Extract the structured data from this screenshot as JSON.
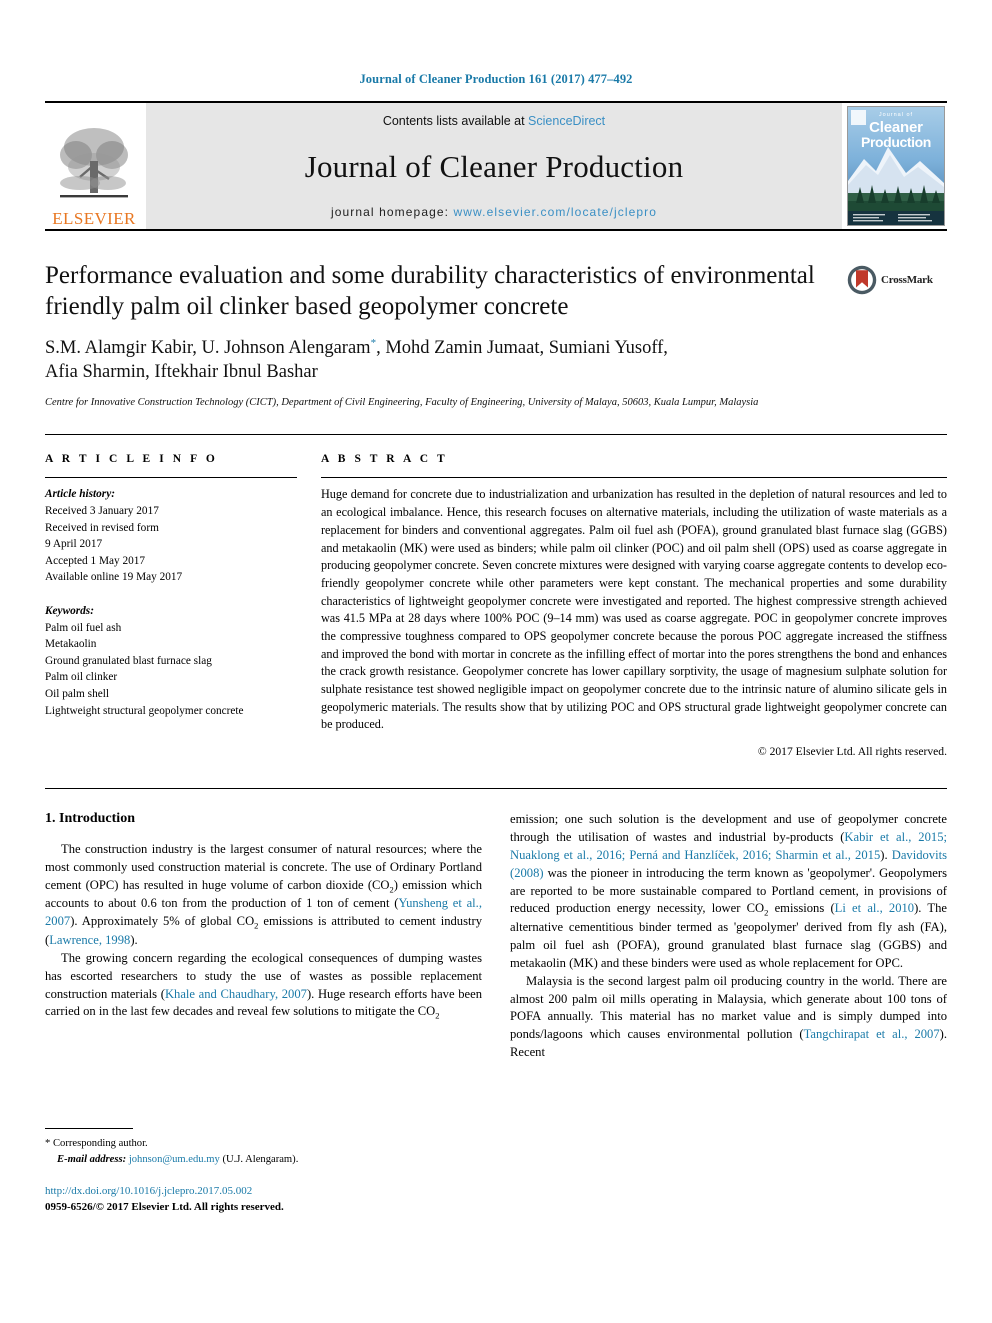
{
  "running_head": "Journal of Cleaner Production 161 (2017) 477–492",
  "masthead": {
    "publisher_name": "ELSEVIER",
    "contents_prefix": "Contents lists available at ",
    "contents_link": "ScienceDirect",
    "journal_name": "Journal of Cleaner Production",
    "homepage_prefix": "journal homepage: ",
    "homepage_url": "www.elsevier.com/locate/jclepro",
    "cover": {
      "line_small": "Journal of",
      "line_big_1": "Cleaner",
      "line_big_2": "Production"
    }
  },
  "article": {
    "title": "Performance evaluation and some durability characteristics of environmental friendly palm oil clinker based geopolymer concrete",
    "crossmark_label": "CrossMark",
    "authors_line1_a": "S.M. Alamgir Kabir, U. Johnson Alengaram",
    "authors_marker": "*",
    "authors_line1_b": ", Mohd Zamin Jumaat, Sumiani Yusoff,",
    "authors_line2": "Afia Sharmin, Iftekhair Ibnul Bashar",
    "affiliation": "Centre for Innovative Construction Technology (CICT), Department of Civil Engineering, Faculty of Engineering, University of Malaya, 50603, Kuala Lumpur, Malaysia"
  },
  "article_info": {
    "heading": "A R T I C L E   I N F O",
    "history_label": "Article history:",
    "history": [
      "Received 3 January 2017",
      "Received in revised form",
      "9 April 2017",
      "Accepted 1 May 2017",
      "Available online 19 May 2017"
    ],
    "keywords_label": "Keywords:",
    "keywords": [
      "Palm oil fuel ash",
      "Metakaolin",
      "Ground granulated blast furnace slag",
      "Palm oil clinker",
      "Oil palm shell",
      "Lightweight structural geopolymer concrete"
    ]
  },
  "abstract": {
    "heading": "A B S T R A C T",
    "text": "Huge demand for concrete due to industrialization and urbanization has resulted in the depletion of natural resources and led to an ecological imbalance. Hence, this research focuses on alternative materials, including the utilization of waste materials as a replacement for binders and conventional aggregates. Palm oil fuel ash (POFA), ground granulated blast furnace slag (GGBS) and metakaolin (MK) were used as binders; while palm oil clinker (POC) and oil palm shell (OPS) used as coarse aggregate in producing geopolymer concrete. Seven concrete mixtures were designed with varying coarse aggregate contents to develop eco-friendly geopolymer concrete while other parameters were kept constant. The mechanical properties and some durability characteristics of lightweight geopolymer concrete were investigated and reported. The highest compressive strength achieved was 41.5 MPa at 28 days where 100% POC (9–14 mm) was used as coarse aggregate. POC in geopolymer concrete improves the compressive toughness compared to OPS geopolymer concrete because the porous POC aggregate increased the stiffness and improved the bond with mortar in concrete as the infilling effect of mortar into the pores strengthens the bond and enhances the crack growth resistance. Geopolymer concrete has lower capillary sorptivity, the usage of magnesium sulphate solution for sulphate resistance test showed negligible impact on geopolymer concrete due to the intrinsic nature of alumino silicate gels in geopolymeric materials. The results show that by utilizing POC and OPS structural grade lightweight geopolymer concrete can be produced.",
    "copyright": "© 2017 Elsevier Ltd. All rights reserved."
  },
  "introduction": {
    "section_number_title": "1. Introduction",
    "left_para1_a": "The construction industry is the largest consumer of natural resources; where the most commonly used construction material is concrete. The use of Ordinary Portland cement (OPC) has resulted in huge volume of carbon dioxide (CO",
    "left_para1_b": ") emission which accounts to about 0.6 ton from the production of 1 ton of cement (",
    "left_para1_cite1": "Yunsheng et al., 2007",
    "left_para1_c": "). Approximately 5% of global CO",
    "left_para1_d": " emissions is attributed to cement industry (",
    "left_para1_cite2": "Lawrence, 1998",
    "left_para1_e": ").",
    "left_para2_a": "The growing concern regarding the ecological consequences of dumping wastes has escorted researchers to study the use of wastes as possible replacement construction materials (",
    "left_para2_cite1": "Khale and Chaudhary, 2007",
    "left_para2_b": "). Huge research efforts have been carried on in the last few decades and reveal few solutions to mitigate the CO",
    "right_para1_a": "emission; one such solution is the development and use of geopolymer concrete through the utilisation of wastes and industrial by-products (",
    "right_para1_cite1": "Kabir et al., 2015; Nuaklong et al., 2016; Perná and Hanzlíček, 2016; Sharmin et al., 2015",
    "right_para1_b": "). ",
    "right_para1_cite2": "Davidovits (2008)",
    "right_para1_c": " was the pioneer in introducing the term known as 'geopolymer'. Geopolymers are reported to be more sustainable compared to Portland cement, in provisions of reduced production energy necessity, lower CO",
    "right_para1_d": " emissions (",
    "right_para1_cite3": "Li et al., 2010",
    "right_para1_e": "). The alternative cementitious binder termed as 'geopolymer' derived from fly ash (FA), palm oil fuel ash (POFA), ground granulated blast furnace slag (GGBS) and metakaolin (MK) and these binders were used as whole replacement for OPC.",
    "right_para2_a": "Malaysia is the second largest palm oil producing country in the world. There are almost 200 palm oil mills operating in Malaysia, which generate about 100 tons of POFA annually. This material has no market value and is simply dumped into ponds/lagoons which causes environmental pollution (",
    "right_para2_cite1": "Tangchirapat et al., 2007",
    "right_para2_b": "). Recent"
  },
  "footer": {
    "corresponding_marker": "*",
    "corresponding_label": "Corresponding author.",
    "email_label": "E-mail address:",
    "email": "johnson@um.edu.my",
    "email_owner": "(U.J. Alengaram).",
    "doi_url": "http://dx.doi.org/10.1016/j.jclepro.2017.05.002",
    "issn_line": "0959-6526/© 2017 Elsevier Ltd. All rights reserved."
  },
  "colors": {
    "link_blue": "#1a7aa8",
    "elsevier_orange": "#e87722",
    "masthead_grey": "#e6e6e6"
  }
}
